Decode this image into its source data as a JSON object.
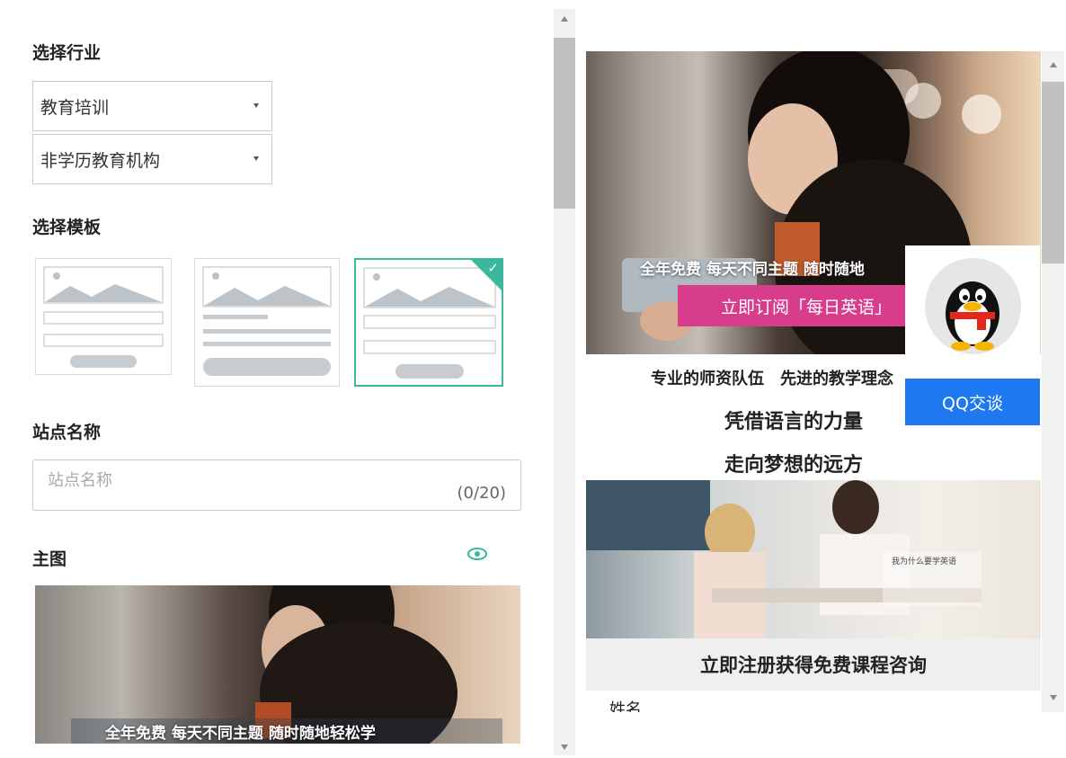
{
  "settings": {
    "industry_label": "选择行业",
    "industry_value": "教育培训",
    "sub_industry_value": "非学历教育机构",
    "template_label": "选择模板",
    "site_name_label": "站点名称",
    "site_name_placeholder": "站点名称",
    "site_name_counter": "(0/20)",
    "main_image_label": "主图",
    "main_image_caption": "全年免费 每天不同主题 随时随地轻松学",
    "selected_template_index": 3
  },
  "preview": {
    "hero_line1": "全年免费 每天不同主题 随时随地",
    "hero_pink": "立即订阅「每日英语」",
    "feature_line": "专业的师资队伍　先进的教学理念",
    "slogan_line1": "凭借语言的力量",
    "slogan_line2": "走向梦想的远方",
    "classroom_text": "我为什么要学英语",
    "cta": "立即注册获得免费课程咨询",
    "partial_bottom": "姓名"
  },
  "qq_widget": {
    "button_label": "QQ交谈"
  },
  "colors": {
    "accent_green": "#3bb89c",
    "qq_blue": "#1e78f0",
    "pink": "#d83d8c"
  }
}
